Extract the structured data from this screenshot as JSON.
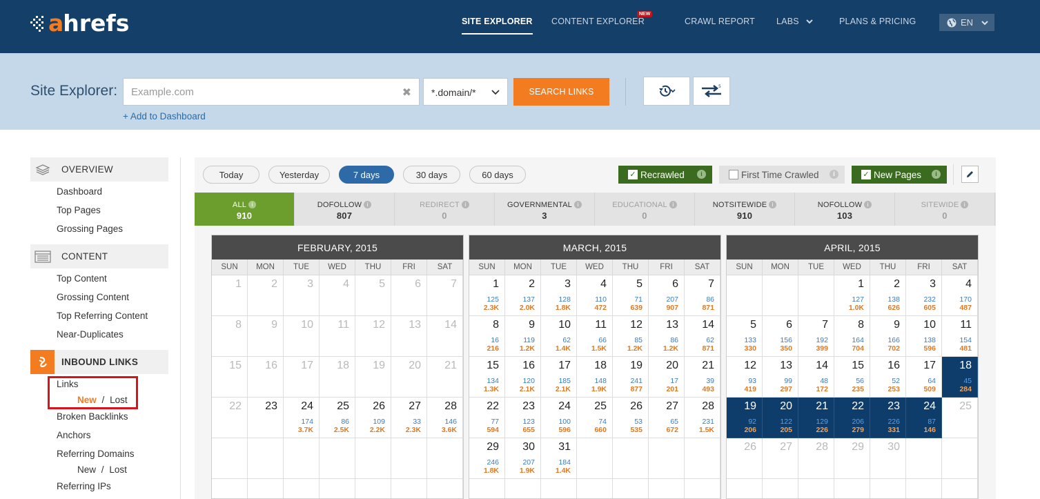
{
  "header": {
    "logo_a": "a",
    "logo_rest": "hrefs",
    "nav": [
      "SITE EXPLORER",
      "CONTENT EXPLORER",
      "CRAWL REPORT",
      "LABS",
      "PLANS & PRICING"
    ],
    "new_badge": "NEW",
    "lang": "EN"
  },
  "search": {
    "title": "Site Explorer:",
    "placeholder": "Example.com",
    "mode": "*.domain/*",
    "button": "SEARCH LINKS",
    "add_dashboard": "+ Add to Dashboard"
  },
  "sidebar": {
    "overview": "OVERVIEW",
    "overview_items": [
      "Dashboard",
      "Top Pages",
      "Grossing Pages"
    ],
    "content": "CONTENT",
    "content_items": [
      "Top Content",
      "Grossing Content",
      "Top Referring Content",
      "Near-Duplicates"
    ],
    "inbound": "INBOUND LINKS",
    "links": "Links",
    "links_new": "New",
    "links_lost": "Lost",
    "slash": "/",
    "inbound_items": [
      "Broken Backlinks",
      "Anchors",
      "Referring Domains"
    ],
    "rd_new": "New",
    "rd_lost": "Lost",
    "referring_ips": "Referring IPs"
  },
  "filters": {
    "periods": [
      "Today",
      "Yesterday",
      "7 days",
      "30 days",
      "60 days"
    ],
    "active_period": "7 days",
    "recrawled": "Recrawled",
    "first_time": "First Time Crawled",
    "new_pages": "New Pages",
    "info": "i",
    "check": "✓"
  },
  "tabs": [
    {
      "label": "ALL",
      "count": "910"
    },
    {
      "label": "DOFOLLOW",
      "count": "807"
    },
    {
      "label": "REDIRECT",
      "count": "0"
    },
    {
      "label": "GOVERNMENTAL",
      "count": "3"
    },
    {
      "label": "EDUCATIONAL",
      "count": "0"
    },
    {
      "label": "NOTSITEWIDE",
      "count": "910"
    },
    {
      "label": "NOFOLLOW",
      "count": "103"
    },
    {
      "label": "SITEWIDE",
      "count": "0"
    }
  ],
  "weekdays": [
    "SUN",
    "MON",
    "TUE",
    "WED",
    "THU",
    "FRI",
    "SAT"
  ],
  "calendars": [
    {
      "title": "FEBRUARY, 2015",
      "rows": [
        [
          {
            "d": "1",
            "o": 1
          },
          {
            "d": "2",
            "o": 1
          },
          {
            "d": "3",
            "o": 1
          },
          {
            "d": "4",
            "o": 1
          },
          {
            "d": "5",
            "o": 1
          },
          {
            "d": "6",
            "o": 1
          },
          {
            "d": "7",
            "o": 1
          }
        ],
        [
          {
            "d": "8",
            "o": 1
          },
          {
            "d": "9",
            "o": 1
          },
          {
            "d": "10",
            "o": 1
          },
          {
            "d": "11",
            "o": 1
          },
          {
            "d": "12",
            "o": 1
          },
          {
            "d": "13",
            "o": 1
          },
          {
            "d": "14",
            "o": 1
          }
        ],
        [
          {
            "d": "15",
            "o": 1
          },
          {
            "d": "16",
            "o": 1
          },
          {
            "d": "17",
            "o": 1
          },
          {
            "d": "18",
            "o": 1
          },
          {
            "d": "19",
            "o": 1
          },
          {
            "d": "20",
            "o": 1
          },
          {
            "d": "21",
            "o": 1
          }
        ],
        [
          {
            "d": "22",
            "o": 1
          },
          {
            "d": "23"
          },
          {
            "d": "24",
            "a": "174",
            "b": "3.7K"
          },
          {
            "d": "25",
            "a": "86",
            "b": "2.5K"
          },
          {
            "d": "26",
            "a": "109",
            "b": "2.2K"
          },
          {
            "d": "27",
            "a": "33",
            "b": "2.3K"
          },
          {
            "d": "28",
            "a": "146",
            "b": "3.6K"
          }
        ],
        [
          {},
          {},
          {},
          {},
          {},
          {},
          {}
        ],
        [
          {},
          {},
          {},
          {},
          {},
          {},
          {}
        ]
      ]
    },
    {
      "title": "MARCH, 2015",
      "rows": [
        [
          {
            "d": "1",
            "a": "125",
            "b": "2.3K"
          },
          {
            "d": "2",
            "a": "137",
            "b": "2.0K"
          },
          {
            "d": "3",
            "a": "128",
            "b": "1.8K"
          },
          {
            "d": "4",
            "a": "110",
            "b": "472"
          },
          {
            "d": "5",
            "a": "71",
            "b": "639"
          },
          {
            "d": "6",
            "a": "207",
            "b": "907"
          },
          {
            "d": "7",
            "a": "86",
            "b": "871"
          }
        ],
        [
          {
            "d": "8",
            "a": "16",
            "b": "216"
          },
          {
            "d": "9",
            "a": "119",
            "b": "1.2K"
          },
          {
            "d": "10",
            "a": "62",
            "b": "1.4K"
          },
          {
            "d": "11",
            "a": "66",
            "b": "1.5K"
          },
          {
            "d": "12",
            "a": "85",
            "b": "1.2K"
          },
          {
            "d": "13",
            "a": "86",
            "b": "1.2K"
          },
          {
            "d": "14",
            "a": "62",
            "b": "871"
          }
        ],
        [
          {
            "d": "15",
            "a": "134",
            "b": "1.3K"
          },
          {
            "d": "16",
            "a": "120",
            "b": "2.1K"
          },
          {
            "d": "17",
            "a": "185",
            "b": "2.1K"
          },
          {
            "d": "18",
            "a": "148",
            "b": "1.9K"
          },
          {
            "d": "19",
            "a": "241",
            "b": "877"
          },
          {
            "d": "20",
            "a": "17",
            "b": "201"
          },
          {
            "d": "21",
            "a": "39",
            "b": "493"
          }
        ],
        [
          {
            "d": "22",
            "a": "77",
            "b": "594"
          },
          {
            "d": "23",
            "a": "123",
            "b": "655"
          },
          {
            "d": "24",
            "a": "100",
            "b": "596"
          },
          {
            "d": "25",
            "a": "74",
            "b": "660"
          },
          {
            "d": "26",
            "a": "53",
            "b": "535"
          },
          {
            "d": "27",
            "a": "65",
            "b": "672"
          },
          {
            "d": "28",
            "a": "231",
            "b": "1.5K"
          }
        ],
        [
          {
            "d": "29",
            "a": "246",
            "b": "1.8K"
          },
          {
            "d": "30",
            "a": "207",
            "b": "1.9K"
          },
          {
            "d": "31",
            "a": "184",
            "b": "1.4K"
          },
          {},
          {},
          {},
          {}
        ],
        [
          {},
          {},
          {},
          {},
          {},
          {},
          {}
        ]
      ]
    },
    {
      "title": "APRIL, 2015",
      "rows": [
        [
          {},
          {},
          {},
          {
            "d": "1",
            "a": "127",
            "b": "1.0K"
          },
          {
            "d": "2",
            "a": "138",
            "b": "626"
          },
          {
            "d": "3",
            "a": "232",
            "b": "605"
          },
          {
            "d": "4",
            "a": "170",
            "b": "487"
          }
        ],
        [
          {
            "d": "5",
            "a": "133",
            "b": "330"
          },
          {
            "d": "6",
            "a": "156",
            "b": "350"
          },
          {
            "d": "7",
            "a": "192",
            "b": "399"
          },
          {
            "d": "8",
            "a": "164",
            "b": "704"
          },
          {
            "d": "9",
            "a": "166",
            "b": "702"
          },
          {
            "d": "10",
            "a": "138",
            "b": "596"
          },
          {
            "d": "11",
            "a": "154",
            "b": "481"
          }
        ],
        [
          {
            "d": "12",
            "a": "93",
            "b": "419"
          },
          {
            "d": "13",
            "a": "99",
            "b": "297"
          },
          {
            "d": "14",
            "a": "48",
            "b": "172"
          },
          {
            "d": "15",
            "a": "56",
            "b": "235"
          },
          {
            "d": "16",
            "a": "52",
            "b": "253"
          },
          {
            "d": "17",
            "a": "64",
            "b": "509"
          },
          {
            "d": "18",
            "a": "45",
            "b": "284",
            "s": 1
          }
        ],
        [
          {
            "d": "19",
            "a": "92",
            "b": "206",
            "s": 1
          },
          {
            "d": "20",
            "a": "122",
            "b": "205",
            "s": 1
          },
          {
            "d": "21",
            "a": "129",
            "b": "226",
            "s": 1
          },
          {
            "d": "22",
            "a": "206",
            "b": "279",
            "s": 1
          },
          {
            "d": "23",
            "a": "226",
            "b": "331",
            "s": 1
          },
          {
            "d": "24",
            "a": "87",
            "b": "146",
            "s": 1
          },
          {
            "d": "25",
            "o": 1
          }
        ],
        [
          {
            "d": "26",
            "o": 1
          },
          {
            "d": "27",
            "o": 1
          },
          {
            "d": "28",
            "o": 1
          },
          {
            "d": "29",
            "o": 1
          },
          {
            "d": "30",
            "o": 1
          },
          {},
          {}
        ],
        [
          {},
          {},
          {},
          {},
          {},
          {},
          {}
        ]
      ]
    }
  ],
  "colors": {
    "header_bg": "#143f69",
    "band_bg": "#c5d8ea",
    "accent_orange": "#f47c20",
    "active_green": "#6c9e2e",
    "selected_day": "#0e3d6b"
  }
}
